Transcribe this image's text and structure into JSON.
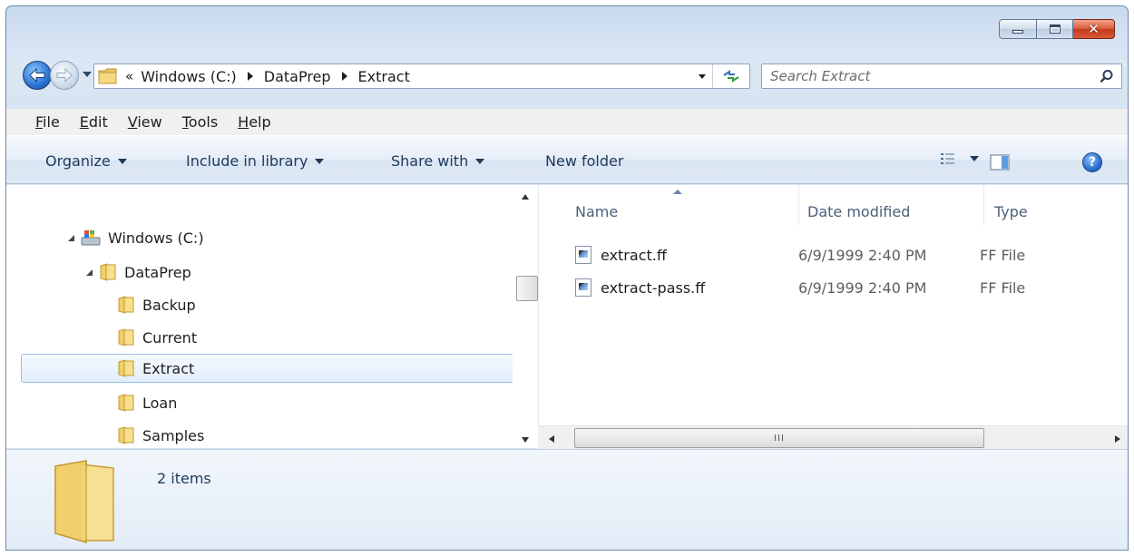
{
  "window": {
    "minimize_icon": "minimize-icon",
    "maximize_icon": "maximize-icon",
    "close_icon": "close-icon"
  },
  "navigation": {
    "back_icon": "back-arrow-icon",
    "forward_icon": "forward-arrow-icon",
    "overflow": "«",
    "breadcrumbs": [
      "Windows (C:)",
      "DataPrep",
      "Extract"
    ]
  },
  "search": {
    "placeholder": "Search Extract"
  },
  "menu": [
    "File",
    "Edit",
    "View",
    "Tools",
    "Help"
  ],
  "commandbar": {
    "organize": "Organize",
    "include_in_library": "Include in library",
    "share_with": "Share with",
    "new_folder": "New folder"
  },
  "tree": {
    "items": [
      {
        "label": "Windows (C:)",
        "icon": "drive-icon",
        "expanded": true
      },
      {
        "label": "DataPrep",
        "icon": "folder-icon",
        "expanded": true
      },
      {
        "label": "Backup",
        "icon": "folder-icon"
      },
      {
        "label": "Current",
        "icon": "folder-icon"
      },
      {
        "label": "Extract",
        "icon": "folder-icon",
        "selected": true
      },
      {
        "label": "Loan",
        "icon": "folder-icon"
      },
      {
        "label": "Samples",
        "icon": "folder-icon"
      }
    ]
  },
  "columns": {
    "name": "Name",
    "date_modified": "Date modified",
    "type": "Type"
  },
  "files": [
    {
      "name": "extract.ff",
      "date": "6/9/1999 2:40 PM",
      "type": "FF File"
    },
    {
      "name": "extract-pass.ff",
      "date": "6/9/1999 2:40 PM",
      "type": "FF File"
    }
  ],
  "scrollbar": {
    "grip": "III"
  },
  "details": {
    "item_count": "2 items"
  },
  "colors": {
    "selection_border": "#97bde6",
    "command_text": "#1e395b",
    "close_button": "#c43b1c"
  }
}
